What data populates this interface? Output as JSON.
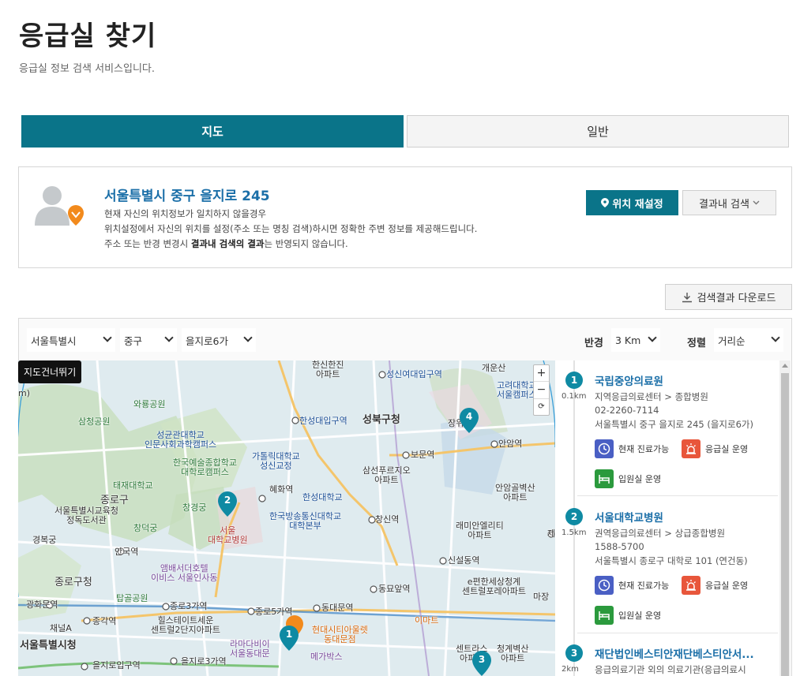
{
  "page": {
    "title": "응급실 찾기",
    "subtitle": "응급실 정보 검색 서비스입니다."
  },
  "tabs": [
    {
      "label": "지도",
      "active": true
    },
    {
      "label": "일반",
      "active": false
    }
  ],
  "location": {
    "address": "서울특별시 중구 을지로 245",
    "desc_line1": "현재 자신의 위치정보가 일치하지 않을경우",
    "desc_line2": "위치설정에서 자신의 위치를 설정(주소 또는 명칭 검색)하시면 정확한 주변 정보를 제공해드립니다.",
    "desc_line3_pre": "주소 또는 반경 변경시 ",
    "desc_line3_bold": "결과내 검색의 결과",
    "desc_line3_post": "는 반영되지 않습니다.",
    "reset_button": "위치 재설정",
    "filter_button": "결과내 검색"
  },
  "download_button": "검색결과 다운로드",
  "filters": {
    "city": "서울특별시",
    "district": "중구",
    "dong": "을지로6가",
    "radius_label": "반경",
    "radius_value": "3 Km",
    "sort_label": "정렬",
    "sort_value": "거리순"
  },
  "map": {
    "skip_button": "지도건너뛰기",
    "zoom_in": "+",
    "zoom_out": "−",
    "refresh": "⟳",
    "labels": {
      "l1": "한신한진\n아파트",
      "l2": "성신여대입구역",
      "l3": "개운산",
      "l4": "고려대학교\n서울캠퍼스",
      "l5": "와룡공원",
      "l6": "삼청공원",
      "l7": "성균관대학교\n인문사회과학캠퍼스",
      "l8": "한성대입구역",
      "l9": "성북구청",
      "l10": "장위",
      "l11": "안암역",
      "l12": "한국예술종합학교\n대학로캠퍼스",
      "l13": "가톨릭대학교\n성신교정",
      "l14": "보문역",
      "l15": "삼선푸르지오\n아파트",
      "l16": "태재대학교",
      "l17": "혜화역",
      "l18": "한성대학교",
      "l19": "안암골벽산\n아파트",
      "l20": "종로구",
      "l21": "창경궁",
      "l22": "서울특별시교육청\n정독도서관",
      "l23": "서울\n대학교병원",
      "l24": "한국방송통신대학교\n대학본부",
      "l25": "창신역",
      "l26": "래미안엘리티\n아파트",
      "l27": "경복궁",
      "l28": "창덕궁",
      "l29": "안국역",
      "l30": "신설동역",
      "l31": "앰배서더호텔\n이비스 서울인사동",
      "l32": "종로구청",
      "l33": "e편한세상청계\n센트럴포레아파트",
      "l34": "탑골공원",
      "l35": "동묘앞역",
      "l36": "광화문역",
      "l37": "종로3가역",
      "l38": "종로5가역",
      "l39": "동대문역",
      "l40": "종각역",
      "l41": "힐스테이트세운\n센트럴2단지아파트",
      "l42": "채널A",
      "l43": "현대시티아울렛\n동대문점",
      "l44": "이마트",
      "l45": "서울특별시청",
      "l46": "라마다비이\n서울동대문",
      "l47": "메가박스",
      "l48": "을지로입구역",
      "l49": "을지로3가역",
      "l50": "센트라스\n아파트",
      "l51": "청계벽산\n아파트",
      "l52": "마장",
      "l53": "제",
      "l54": "m)"
    },
    "markers": [
      "1",
      "2",
      "3",
      "4"
    ]
  },
  "results": [
    {
      "num": "1",
      "distance": "0.1km",
      "name": "국립중앙의료원",
      "category": "지역응급의료센터 > 종합병원",
      "phone": "02-2260-7114",
      "address": "서울특별시 중구 을지로 245 (을지로6가)",
      "badge1": "현재 진료가능",
      "badge2": "응급실 운영",
      "badge3": "입원실 운영"
    },
    {
      "num": "2",
      "distance": "1.5km",
      "name": "서울대학교병원",
      "category": "권역응급의료센터 > 상급종합병원",
      "phone": "1588-5700",
      "address": "서울특별시 종로구 대학로 101 (연건동)",
      "badge1": "현재 진료가능",
      "badge2": "응급실 운영",
      "badge3": "입원실 운영"
    },
    {
      "num": "3",
      "distance": "2km",
      "name": "재단법인베스티안재단베스티안서...",
      "category": "응급의료기관 외의 의료기관(응급의료시"
    }
  ],
  "colors": {
    "primary": "#0a7489",
    "link": "#1b6fa8",
    "marker": "#0f8aa3",
    "current_marker": "#f28a1c"
  }
}
